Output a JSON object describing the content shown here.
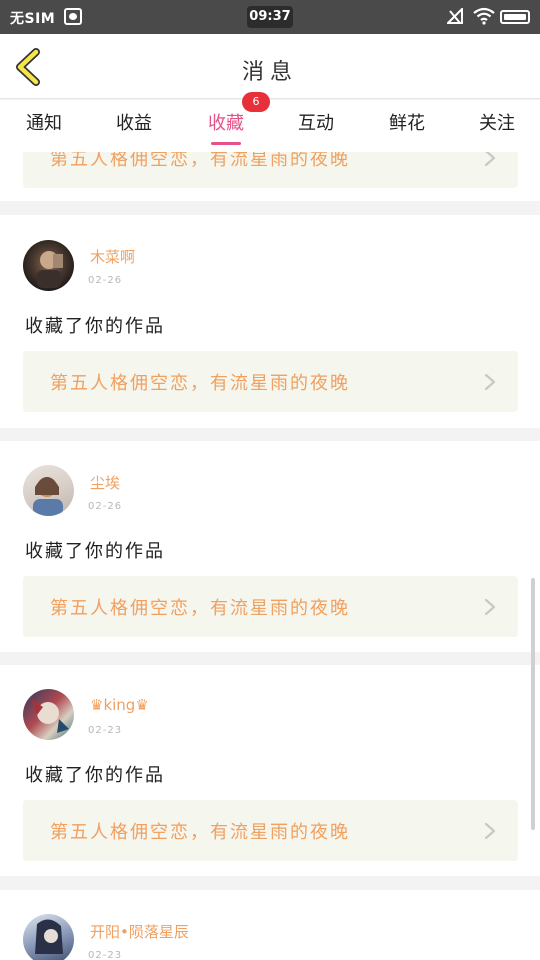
{
  "status_bar": {
    "carrier": "无SIM",
    "time": "09:37"
  },
  "header": {
    "title": "消息"
  },
  "tabs": [
    {
      "label": "通知"
    },
    {
      "label": "收益"
    },
    {
      "label": "收藏",
      "active": true,
      "badge": "6"
    },
    {
      "label": "互动"
    },
    {
      "label": "鲜花"
    },
    {
      "label": "关注"
    }
  ],
  "items": [
    {
      "work_title": "第五人格佣空恋，有流星雨的夜晚"
    },
    {
      "username": "木菜啊",
      "date": "02-26",
      "action": "收藏了你的作品",
      "work_title": "第五人格佣空恋，有流星雨的夜晚"
    },
    {
      "username": "尘埃",
      "date": "02-26",
      "action": "收藏了你的作品",
      "work_title": "第五人格佣空恋，有流星雨的夜晚"
    },
    {
      "username": "♛king♛",
      "date": "02-23",
      "action": "收藏了你的作品",
      "work_title": "第五人格佣空恋，有流星雨的夜晚"
    },
    {
      "username": "开阳•陨落星辰",
      "date": "02-23"
    }
  ],
  "colors": {
    "accent_pink": "#e8508a",
    "username_orange": "#f0a060",
    "badge_red": "#e8303a",
    "work_box_bg": "#f5f6ed"
  }
}
